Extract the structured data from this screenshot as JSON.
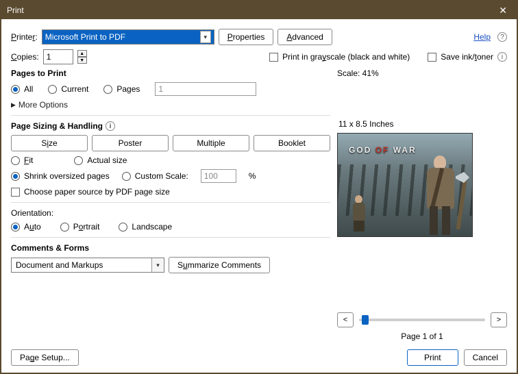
{
  "title": "Print",
  "top": {
    "printer_label": "Printer:",
    "printer_value": "Microsoft Print to PDF",
    "properties": "Properties",
    "advanced": "Advanced",
    "help": "Help",
    "copies_label": "Copies:",
    "copies_value": "1",
    "grayscale": "Print in grayscale (black and white)",
    "saveink": "Save ink/toner"
  },
  "pages": {
    "title": "Pages to Print",
    "all": "All",
    "current": "Current",
    "pages": "Pages",
    "pages_value": "1",
    "more": "More Options"
  },
  "sizing": {
    "title": "Page Sizing & Handling",
    "size": "Size",
    "poster": "Poster",
    "multiple": "Multiple",
    "booklet": "Booklet",
    "fit": "Fit",
    "actual": "Actual size",
    "shrink": "Shrink oversized pages",
    "custom": "Custom Scale:",
    "custom_value": "100",
    "pct": "%",
    "choose_source": "Choose paper source by PDF page size"
  },
  "orientation": {
    "title": "Orientation:",
    "auto": "Auto",
    "portrait": "Portrait",
    "landscape": "Landscape"
  },
  "comments": {
    "title": "Comments & Forms",
    "value": "Document and Markups",
    "summarize": "Summarize Comments"
  },
  "preview": {
    "scale": "Scale:  41%",
    "dims": "11 x 8.5 Inches",
    "logo_a": "G",
    "logo_b": "O",
    "logo_c": "D ",
    "logo_om": "OF",
    "logo_d": " WAR",
    "pageof": "Page 1 of 1",
    "prev": "<",
    "next": ">"
  },
  "footer": {
    "pagesetup": "Page Setup...",
    "print": "Print",
    "cancel": "Cancel"
  }
}
